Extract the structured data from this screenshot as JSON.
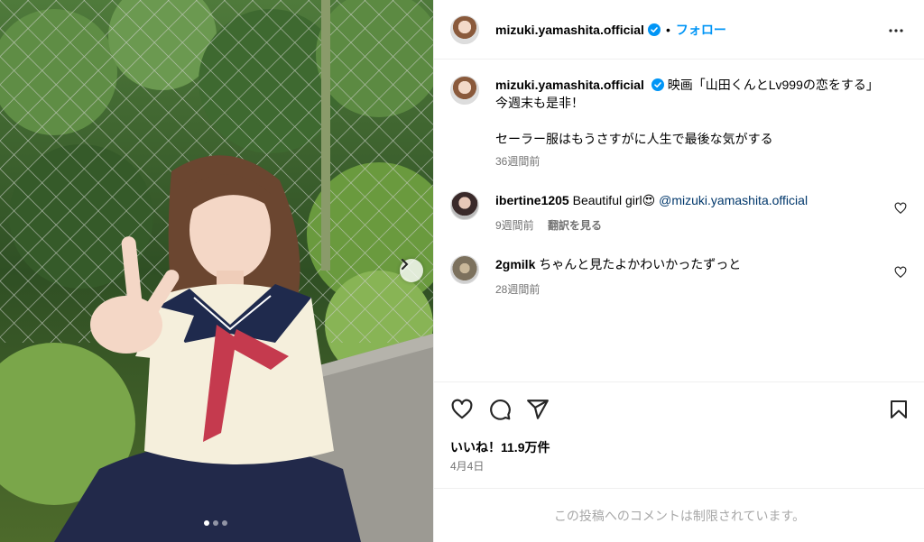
{
  "post": {
    "username": "mizuki.yamashita.official",
    "follow_label": "フォロー",
    "separator": "•",
    "caption_line1": "映画「山田くんとLv999の恋をする」",
    "caption_line2": "今週末も是非！",
    "caption_line3": "セーラー服はもうさすがに人生で最後な気がする",
    "caption_time": "36週間前",
    "likes": "いいね！11.9万件",
    "date": "4月4日",
    "comments_restricted": "この投稿へのコメントは制限されています。"
  },
  "comments": [
    {
      "username": "ibertine1205",
      "text": "Beautiful girl",
      "emoji": "😍",
      "mention": "@mizuki.yamashita.official",
      "time": "9週間前",
      "translate": "翻訳を見る"
    },
    {
      "username": "2gmilk",
      "text": "ちゃんと見たよかわいかったずっと",
      "time": "28週間前"
    }
  ],
  "carousel": {
    "total": 3,
    "active": 1
  },
  "icons": {
    "more": "more-options-icon",
    "verified": "verified-badge-icon",
    "like": "heart-icon",
    "comment": "comment-icon",
    "share": "share-icon",
    "save": "bookmark-icon",
    "next": "chevron-right-icon"
  },
  "colors": {
    "link": "#0095f6",
    "verified": "#0095f6",
    "muted": "#737373",
    "mention": "#00376b"
  }
}
